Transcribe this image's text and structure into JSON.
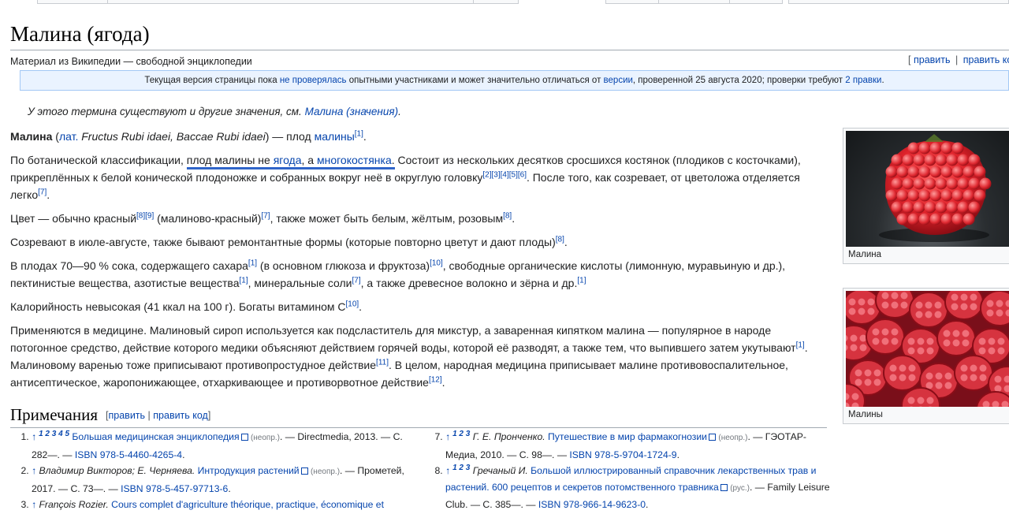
{
  "page": {
    "title": "Малина (ягода)",
    "site_sub": "Материал из Википедии — свободной энциклопедии",
    "edit_links": {
      "open": "[",
      "edit": "править",
      "sep": "|",
      "edit_code": "править ко"
    }
  },
  "notice": {
    "t1": "Текущая версия страницы пока",
    "link1": "не проверялась",
    "t2": "опытными участниками и может значительно отличаться от",
    "link2": "версии",
    "t3": ", проверенной 25 августа 2020; проверки требуют",
    "link3": "2 правки",
    "t4": "."
  },
  "hatnote": {
    "text": "У этого термина существуют и другие значения, см.",
    "link": "Малина (значения)",
    "end": "."
  },
  "article": {
    "p1": {
      "bold": "Малина",
      "open": " (",
      "lat": "лат.",
      "latin": " Fructus Rubi idaei, Baccae Rubi idaei",
      "mid": ") — плод ",
      "link": "малины",
      "ref": "[1]",
      "end": "."
    },
    "p2": {
      "t1": "По ботанической классификации, ",
      "u1": "плод малины не ",
      "ulink1": "ягода",
      "u2": ", а ",
      "ulink2": "многокостянка",
      "u3": ".",
      "t2": " Состоит из нескольких десятков сросшихся костянок (плодиков с косточками), прикреплённых к белой конической плодоножке и собранных вокруг неё в округлую головку",
      "refs": "[2][3][4][5][6]",
      "t3": ". После того, как созревает, от цветоложа отделяется легко",
      "ref2": "[7]",
      "t4": "."
    },
    "p3": {
      "t1": "Цвет — обычно красный",
      "r1": "[8][9]",
      "t2": " (малиново-красный)",
      "r2": "[7]",
      "t3": ", также может быть белым, жёлтым, розовым",
      "r3": "[8]",
      "t4": "."
    },
    "p4": {
      "t1": "Созревают в июле-августе, также бывают ремонтантные формы (которые повторно цветут и дают плоды)",
      "r1": "[8]",
      "t2": "."
    },
    "p5": {
      "t1": "В плодах 70—90 % сока, содержащего сахара",
      "r1": "[1]",
      "t2": " (в основном глюкоза и фруктоза)",
      "r2": "[10]",
      "t3": ", свободные органические кислоты (лимонную, муравьиную и др.), пектинистые вещества, азотистые вещества",
      "r3": "[1]",
      "t4": ", минеральные соли",
      "r4": "[7]",
      "t5": ", а также древесное волокно и зёрна и др.",
      "r5": "[1]"
    },
    "p6": {
      "t1": "Калорийность невысокая (41 ккал на 100 г). Богаты витамином C",
      "r1": "[10]",
      "t2": "."
    },
    "p7": {
      "t1": "Применяются в медицине. Малиновый сироп используется как подсластитель для микстур, а заваренная кипятком малина — популярное в народе потогонное средство, действие которого медики объясняют действием горячей воды, которой её разводят, а также тем, что выпившего затем укутывают",
      "r1": "[1]",
      "t2": ". Малиновому варенью тоже приписывают противопростудное действие",
      "r2": "[11]",
      "t3": ". В целом, народная медицина приписывает малине противовоспалительное, антисептическое, жаропонижающее, отхаркивающее и противорвотное действие",
      "r3": "[12]",
      "t4": "."
    }
  },
  "thumbs": [
    {
      "caption": "Малина"
    },
    {
      "caption": "Малины"
    }
  ],
  "notes": {
    "heading": "Примечания",
    "edit_open": "[",
    "edit": "править",
    "sep": "|",
    "edit_code": "править код",
    "edit_close": "]",
    "left": [
      {
        "arrow": "↑",
        "backrefs": "1 2 3 4 5",
        "author": "",
        "title": "Большая медицинская энциклопедия",
        "access": "(неопр.)",
        "rest": ". — Directmedia, 2013. — С. 282—. — ",
        "isbn": "ISBN 978-5-4460-4265-4",
        "end": "."
      },
      {
        "arrow": "↑",
        "backrefs": "",
        "author": "Владимир Викторов; Е. Черняева.",
        "title": "Интродукция растений",
        "access": "(неопр.)",
        "rest": ". — Прометей, 2017. — С. 73—. — ",
        "isbn": "ISBN 978-5-457-97713-6",
        "end": "."
      },
      {
        "arrow": "↑",
        "backrefs": "",
        "author": "François Rozier.",
        "title": "Cours complet d'agriculture théorique, practique, économique et",
        "access": "",
        "rest": "",
        "isbn": "",
        "end": ""
      }
    ],
    "right": [
      {
        "arrow": "↑",
        "backrefs": "1 2 3",
        "author": "Г. Е. Пронченко.",
        "title": "Путешествие в мир фармакогнозии",
        "access": "(неопр.)",
        "rest": ". — ГЭОТАР-Медиа, 2010. — С. 98—. — ",
        "isbn": "ISBN 978-5-9704-1724-9",
        "end": "."
      },
      {
        "arrow": "↑",
        "backrefs": "1 2 3",
        "author": "Гречаный И.",
        "title": "Большой иллюстрированный справочник лекарственных трав и растений. 600 рецептов и секретов потомственного травника",
        "access": "(рус.)",
        "rest": ". — Family Leisure Club. — С. 385—. — ",
        "isbn": "ISBN 978-966-14-9623-0",
        "end": "."
      }
    ]
  },
  "colors": {
    "link": "#0645ad",
    "notice_bg": "#eaf3ff",
    "highlight_underline": "#2f64c9"
  }
}
